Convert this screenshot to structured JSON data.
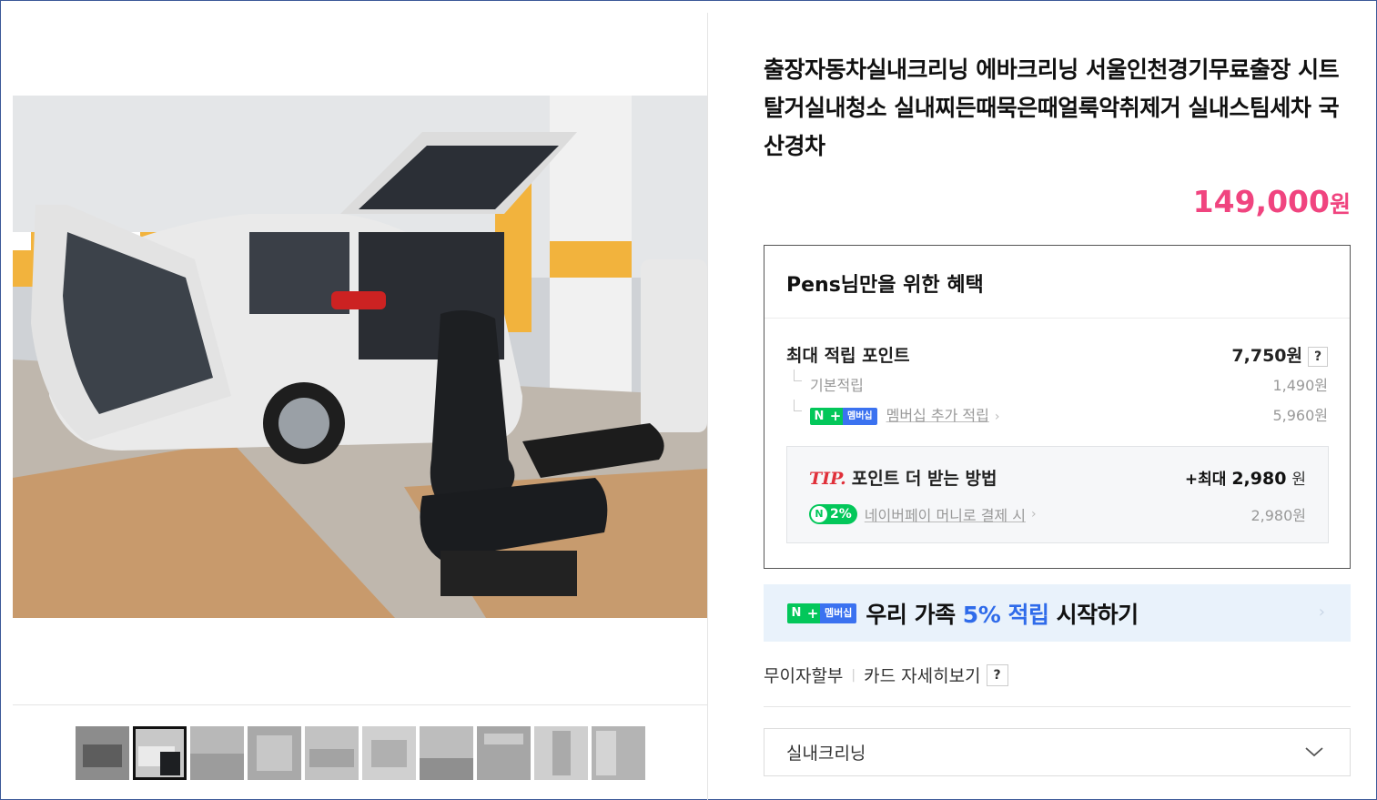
{
  "product": {
    "title": "출장자동차실내크리닝 에바크리닝 서울인천경기무료출장 시트탈거실내청소 실내찌든때묵은때얼룩악취제거 실내스팀세차 국산경차",
    "price": "149,000",
    "price_unit": "원"
  },
  "gallery": {
    "main_image": "car-interior-cleaning-photo",
    "thumb_count": 10,
    "selected_thumb": 2
  },
  "benefits": {
    "heading": "Pens님만을 위한 혜택",
    "max_points_label": "최대 적립 포인트",
    "max_points_value": "7,750원",
    "help_label": "?",
    "basic_label": "기본적립",
    "basic_value": "1,490원",
    "membership_badge_n": "N",
    "membership_badge_plus": "+",
    "membership_badge_text": "멤버십",
    "membership_label": "멤버십 추가 적립",
    "membership_value": "5,960원",
    "tip": {
      "tip_word": "TIP.",
      "label": "포인트 더 받는 방법",
      "max_prefix": "+최대",
      "max_value": "2,980",
      "max_unit": "원",
      "pay_badge_icon": "N",
      "pay_badge_pct": "2%",
      "pay_label": "네이버페이 머니로 결제 시",
      "pay_value": "2,980원"
    }
  },
  "banner": {
    "text_before": "우리 가족 ",
    "highlight": "5% 적립",
    "text_after": " 시작하기",
    "arrow": "›"
  },
  "installment": {
    "label": "무이자할부",
    "separator": "|",
    "card_label": "카드 자세히보기",
    "help_label": "?"
  },
  "option_select": {
    "value": "실내크리닝"
  },
  "colors": {
    "price": "#f0447f",
    "naver_green": "#03c75a",
    "membership_blue": "#3b72f0",
    "highlight_blue": "#2f6bea",
    "banner_bg": "#e9f2fb"
  }
}
